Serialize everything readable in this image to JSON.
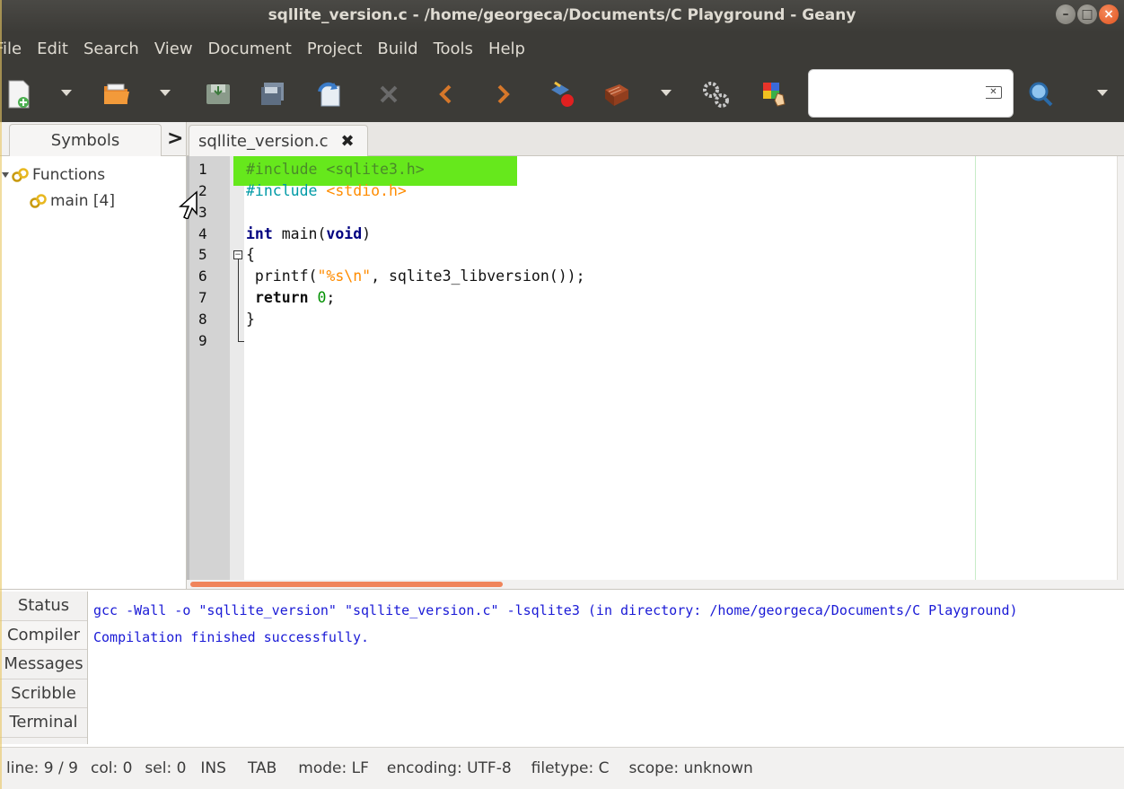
{
  "window": {
    "title": "sqllite_version.c - /home/georgeca/Documents/C Playground - Geany"
  },
  "menubar": {
    "items": [
      "File",
      "Edit",
      "Search",
      "View",
      "Document",
      "Project",
      "Build",
      "Tools",
      "Help"
    ]
  },
  "toolbar": {
    "icons": [
      "new-file-icon",
      "open-file-icon",
      "save-icon",
      "save-all-icon",
      "revert-icon",
      "close-icon",
      "back-icon",
      "forward-icon",
      "compile-icon",
      "build-icon",
      "execute-icon",
      "color-chooser-icon",
      "search-icon"
    ],
    "search_value": ""
  },
  "sidebar": {
    "tab": "Symbols",
    "tree": [
      {
        "label": "Functions"
      },
      {
        "label": "main [4]"
      }
    ]
  },
  "editor": {
    "tab_label": "sqllite_version.c",
    "line_numbers": [
      "1",
      "2",
      "3",
      "4",
      "5",
      "6",
      "7",
      "8",
      "9"
    ],
    "lines": {
      "l1": "#include <sqlite3.h>",
      "l2a": "#include ",
      "l2b": "<stdio.h>",
      "l4a": "int",
      "l4b": " main(",
      "l4c": "void",
      "l4d": ")",
      "l5": "{",
      "l6a": " printf(",
      "l6b": "\"%s\\n\"",
      "l6c": ", sqlite3_libversion());",
      "l7a": " ",
      "l7b": "return",
      "l7c": " ",
      "l7d": "0",
      "l7e": ";",
      "l8": "}"
    }
  },
  "messages": {
    "tabs": [
      "Status",
      "Compiler",
      "Messages",
      "Scribble",
      "Terminal"
    ],
    "active_tab": "Compiler",
    "lines": [
      "gcc -Wall -o \"sqllite_version\" \"sqllite_version.c\" -lsqlite3 (in directory: /home/georgeca/Documents/C Playground)",
      "Compilation finished successfully."
    ]
  },
  "statusbar": {
    "line": "line: 9 / 9",
    "col": "col: 0",
    "sel": "sel: 0",
    "ins": "INS",
    "tab": "TAB",
    "mode": "mode: LF",
    "encoding": "encoding: UTF-8",
    "filetype": "filetype: C",
    "scope": "scope: unknown"
  },
  "colors": {
    "highlight": "#66e81c",
    "preprocessor": "#009aa6",
    "string": "#ff8c00",
    "keyword": "#000080",
    "number": "#009000",
    "compiler_text": "#1a1ad6",
    "close_button": "#e1541f"
  }
}
